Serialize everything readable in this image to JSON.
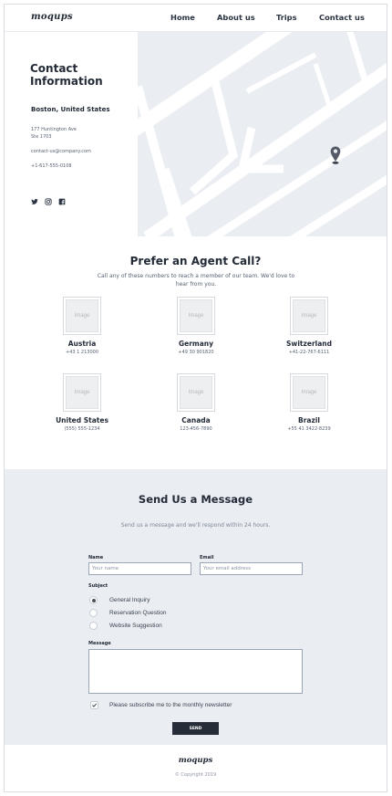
{
  "header": {
    "logo": "moqups",
    "nav": [
      "Home",
      "About us",
      "Trips",
      "Contact us"
    ]
  },
  "contact": {
    "title": "Contact Information",
    "city": "Boston, United States",
    "address_line1": "177 Huntington Ave",
    "address_line2": "Ste 1703",
    "email": "contact-us@company.com",
    "phone": "+1-617-555-0108",
    "social_icons": [
      "twitter-icon",
      "instagram-icon",
      "facebook-icon"
    ]
  },
  "agent": {
    "title": "Prefer an Agent Call?",
    "subtitle": "Call any of these numbers to reach a member of our team. We'd love to hear from you.",
    "image_placeholder": "Image",
    "countries": [
      {
        "name": "Austria",
        "phone": "+43 1 213000"
      },
      {
        "name": "Germany",
        "phone": "+49 30 901820"
      },
      {
        "name": "Switzerland",
        "phone": "+41-22-767-6111"
      },
      {
        "name": "United States",
        "phone": "(555) 555-1234"
      },
      {
        "name": "Canada",
        "phone": "123-456-7890"
      },
      {
        "name": "Brazil",
        "phone": "+55 41 3422-8239"
      }
    ]
  },
  "message": {
    "title": "Send Us a Message",
    "subtitle": "Send us a message and we'll respond within 24 hours.",
    "name_label": "Name",
    "name_placeholder": "Your name",
    "email_label": "Email",
    "email_placeholder": "Your email address",
    "subject_label": "Subject",
    "subjects": [
      "General Inquiry",
      "Reservation Question",
      "Website Suggestion"
    ],
    "selected_subject": "General Inquiry",
    "message_label": "Message",
    "newsletter_label": "Please subscribe me to the monthly newsletter",
    "newsletter_checked": true,
    "send_label": "SEND"
  },
  "footer": {
    "logo": "moqups",
    "copyright": "© Copyright 2019"
  }
}
